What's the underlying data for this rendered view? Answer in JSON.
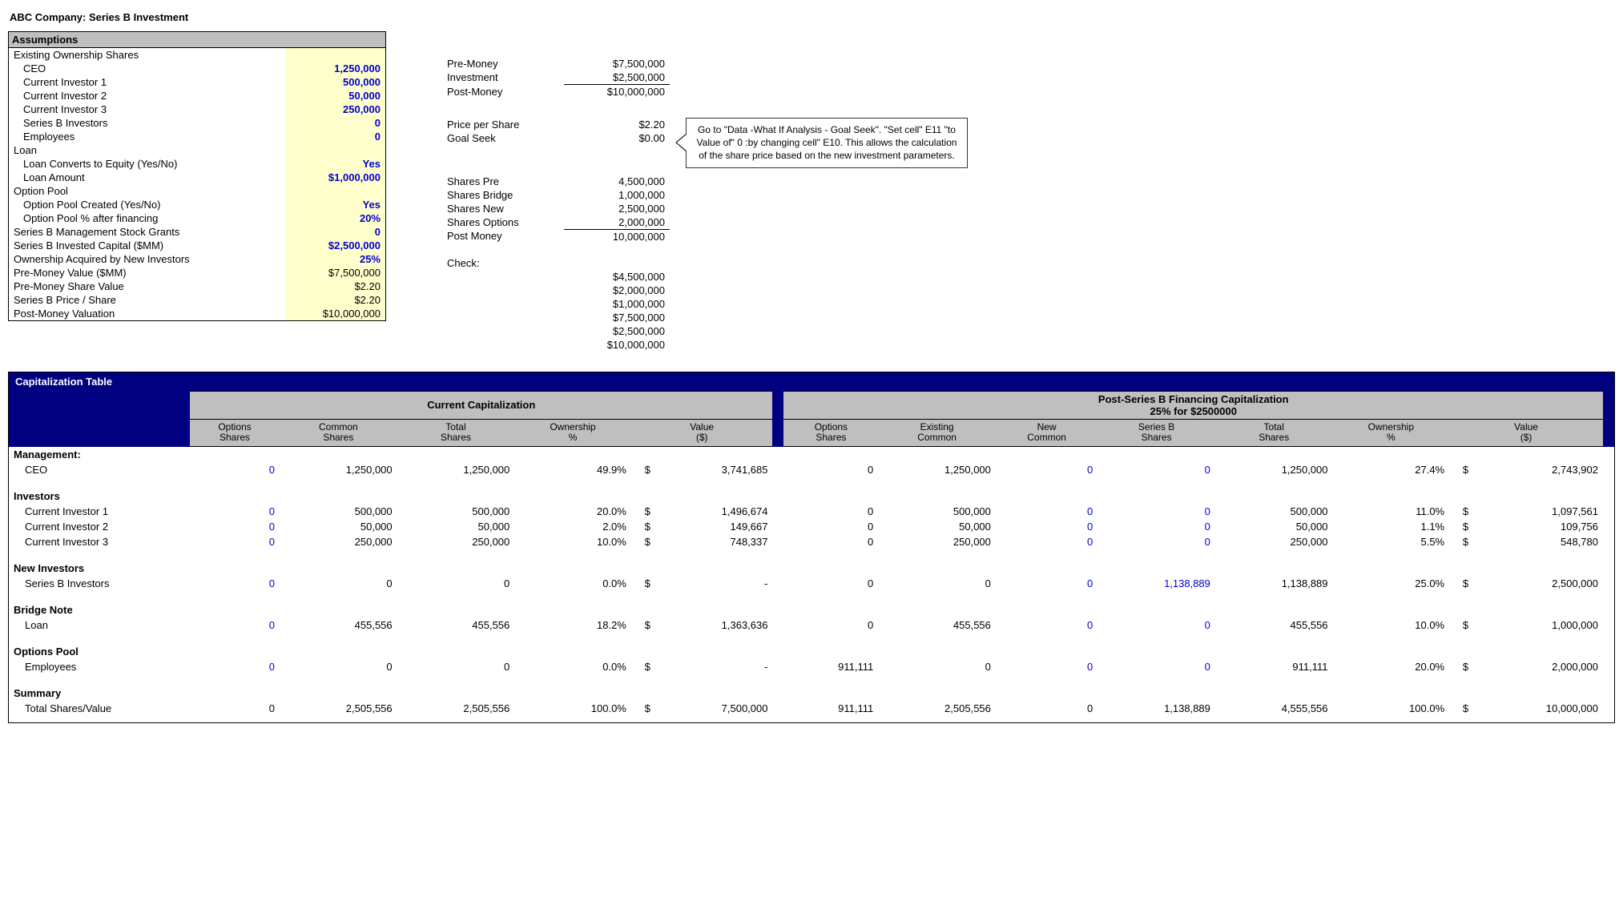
{
  "title": "ABC Company: Series B Investment",
  "assumptions": {
    "header": "Assumptions",
    "existing_label": "Existing Ownership Shares",
    "ceo_label": "CEO",
    "ceo_val": "1,250,000",
    "inv1_label": "Current Investor 1",
    "inv1_val": "500,000",
    "inv2_label": "Current Investor 2",
    "inv2_val": "50,000",
    "inv3_label": "Current Investor 3",
    "inv3_val": "250,000",
    "serb_label": "Series B Investors",
    "serb_val": "0",
    "emp_label": "Employees",
    "emp_val": "0",
    "loan_label": "Loan",
    "loan_conv_label": "Loan Converts to Equity (Yes/No)",
    "loan_conv_val": "Yes",
    "loan_amt_label": "Loan Amount",
    "loan_amt_val": "$1,000,000",
    "opool_label": "Option Pool",
    "opool_created_label": "Option Pool Created (Yes/No)",
    "opool_created_val": "Yes",
    "opool_pct_label": "Option Pool % after financing",
    "opool_pct_val": "20%",
    "mgmt_grants_label": "Series B Management Stock Grants",
    "mgmt_grants_val": "0",
    "invested_label": "Series B Invested Capital ($MM)",
    "invested_val": "$2,500,000",
    "acquired_label": "Ownership Acquired by New Investors",
    "acquired_val": "25%",
    "premoney_label": "Pre-Money Value ($MM)",
    "premoney_val": "$7,500,000",
    "pm_share_label": "Pre-Money Share Value",
    "pm_share_val": "$2.20",
    "serb_price_label": "Series B Price / Share",
    "serb_price_val": "$2.20",
    "postmoney_label": "Post-Money Valuation",
    "postmoney_val": "$10,000,000"
  },
  "calc": {
    "premoney_lbl": "Pre-Money",
    "premoney": "$7,500,000",
    "investment_lbl": "Investment",
    "investment": "$2,500,000",
    "postmoney_lbl": "Post-Money",
    "postmoney": "$10,000,000",
    "pps_lbl": "Price per Share",
    "pps": "$2.20",
    "goalseek_lbl": "Goal Seek",
    "goalseek": "$0.00",
    "shares_pre_lbl": "Shares Pre",
    "shares_pre": "4,500,000",
    "shares_bridge_lbl": "Shares Bridge",
    "shares_bridge": "1,000,000",
    "shares_new_lbl": "Shares New",
    "shares_new": "2,500,000",
    "shares_opt_lbl": "Shares Options",
    "shares_opt": "2,000,000",
    "post_total_lbl": "Post Money",
    "post_total": "10,000,000",
    "check_lbl": "Check:",
    "c1": "$4,500,000",
    "c2": "$2,000,000",
    "c3": "$1,000,000",
    "c4": "$7,500,000",
    "c5": "$2,500,000",
    "c6": "$10,000,000"
  },
  "callout": "Go to \"Data -What If Analysis - Goal Seek\". \"Set cell\" E11 \"to Value of\" 0 :by changing cell\" E10.  This allows the calculation of the share price based on the new investment parameters.",
  "cap": {
    "title": "Capitalization Table",
    "group_current": "Current Capitalization",
    "group_post_l1": "Post-Series B Financing Capitalization",
    "group_post_l2": "25% for $2500000",
    "cols": {
      "opt": "Options\nShares",
      "common": "Common\nShares",
      "total": "Total\nShares",
      "own": "Ownership\n%",
      "val": "Value\n($)",
      "opt2": "Options\nShares",
      "exist": "Existing\nCommon",
      "newc": "New\nCommon",
      "serb": "Series B\nShares",
      "total2": "Total\nShares",
      "own2": "Ownership\n%",
      "val2": "Value\n($)"
    },
    "sec_mgmt": "Management:",
    "sec_inv": "Investors",
    "sec_new": "New Investors",
    "sec_bridge": "Bridge Note",
    "sec_opt": "Options Pool",
    "sec_sum": "Summary",
    "rows": {
      "ceo": {
        "lbl": "CEO",
        "opt": "0",
        "com": "1,250,000",
        "tot": "1,250,000",
        "own": "49.9%",
        "val": "3,741,685",
        "opt2": "0",
        "ex": "1,250,000",
        "nc": "0",
        "sb": "0",
        "tot2": "1,250,000",
        "own2": "27.4%",
        "val2": "2,743,902"
      },
      "i1": {
        "lbl": "Current Investor 1",
        "opt": "0",
        "com": "500,000",
        "tot": "500,000",
        "own": "20.0%",
        "val": "1,496,674",
        "opt2": "0",
        "ex": "500,000",
        "nc": "0",
        "sb": "0",
        "tot2": "500,000",
        "own2": "11.0%",
        "val2": "1,097,561"
      },
      "i2": {
        "lbl": "Current Investor 2",
        "opt": "0",
        "com": "50,000",
        "tot": "50,000",
        "own": "2.0%",
        "val": "149,667",
        "opt2": "0",
        "ex": "50,000",
        "nc": "0",
        "sb": "0",
        "tot2": "50,000",
        "own2": "1.1%",
        "val2": "109,756"
      },
      "i3": {
        "lbl": "Current Investor 3",
        "opt": "0",
        "com": "250,000",
        "tot": "250,000",
        "own": "10.0%",
        "val": "748,337",
        "opt2": "0",
        "ex": "250,000",
        "nc": "0",
        "sb": "0",
        "tot2": "250,000",
        "own2": "5.5%",
        "val2": "548,780"
      },
      "sb": {
        "lbl": "Series B Investors",
        "opt": "0",
        "com": "0",
        "tot": "0",
        "own": "0.0%",
        "val": "-",
        "opt2": "0",
        "ex": "0",
        "nc": "0",
        "sb": "1,138,889",
        "tot2": "1,138,889",
        "own2": "25.0%",
        "val2": "2,500,000"
      },
      "loan": {
        "lbl": "Loan",
        "opt": "0",
        "com": "455,556",
        "tot": "455,556",
        "own": "18.2%",
        "val": "1,363,636",
        "opt2": "0",
        "ex": "455,556",
        "nc": "0",
        "sb": "0",
        "tot2": "455,556",
        "own2": "10.0%",
        "val2": "1,000,000"
      },
      "emp": {
        "lbl": "Employees",
        "opt": "0",
        "com": "0",
        "tot": "0",
        "own": "0.0%",
        "val": "-",
        "opt2": "911,111",
        "ex": "0",
        "nc": "0",
        "sb": "0",
        "tot2": "911,111",
        "own2": "20.0%",
        "val2": "2,000,000"
      },
      "sum": {
        "lbl": "Total Shares/Value",
        "opt": "0",
        "com": "2,505,556",
        "tot": "2,505,556",
        "own": "100.0%",
        "val": "7,500,000",
        "opt2": "911,111",
        "ex": "2,505,556",
        "nc": "0",
        "sb": "1,138,889",
        "tot2": "4,555,556",
        "own2": "100.0%",
        "val2": "10,000,000"
      }
    }
  }
}
